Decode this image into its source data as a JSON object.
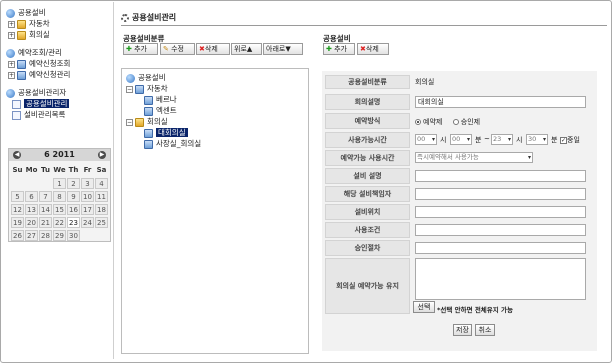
{
  "left_tree": {
    "facility_root": "공용설비",
    "car": "자동차",
    "meeting_room": "회의실",
    "reservation_root": "예약조회/관리",
    "reservation_lookup": "예약신청조회",
    "reservation_manage": "예약신청관리",
    "admin_root": "공용설비관리자",
    "facility_manage": "공용설비관리",
    "facility_list": "설비관리목록"
  },
  "calendar": {
    "month": "6",
    "year": "2011",
    "prev_icon": "chevron-left-icon",
    "next_icon": "chevron-right-icon",
    "weekdays": [
      "Su",
      "Mo",
      "Tu",
      "We",
      "Th",
      "Fr",
      "Sa"
    ],
    "weeks": [
      [
        "",
        "",
        "",
        "1",
        "2",
        "3",
        "4"
      ],
      [
        "5",
        "6",
        "7",
        "8",
        "9",
        "10",
        "11"
      ],
      [
        "12",
        "13",
        "14",
        "15",
        "16",
        "17",
        "18"
      ],
      [
        "19",
        "20",
        "21",
        "22",
        "23",
        "24",
        "25"
      ],
      [
        "26",
        "27",
        "28",
        "29",
        "30",
        "",
        ""
      ]
    ],
    "today": "23"
  },
  "page": {
    "title": "공용설비관리"
  },
  "classification": {
    "title": "공용설비분류",
    "buttons": {
      "add": "추가",
      "edit": "수정",
      "delete": "삭제",
      "up": "위로▲",
      "down": "아래로▼"
    }
  },
  "facility_section": {
    "title": "공용설비",
    "buttons": {
      "add": "추가",
      "delete": "삭제"
    }
  },
  "main_tree": {
    "root": "공용설비",
    "car": "자동차",
    "car_1": "베르나",
    "car_2": "엑센트",
    "meeting_room": "회의실",
    "room_1": "대회의실",
    "room_2": "사장실_회의실"
  },
  "form": {
    "category_label": "공용설비분류",
    "category_value": "회의실",
    "name_label": "회의설명",
    "name_value": "대회의실",
    "method_label": "예약방식",
    "method_options": [
      "예약제",
      "승인제"
    ],
    "time_label": "사용가능시간",
    "time_start_hour": "00",
    "time_start_min": "00",
    "time_end_hour": "23",
    "time_end_min": "30",
    "unit_hour": "시",
    "unit_min": "분",
    "range_sep": "~",
    "stop_label": "중일",
    "status_label": "예약가능 사용시간",
    "status_value": "즉시예약해서 사용가능",
    "desc_label": "설비 설명",
    "manager_label": "해당 설비책임자",
    "location_label": "설비위치",
    "condition_label": "사용조건",
    "approval_label": "승인절차",
    "keep_label": "회의실 예약가능 유지",
    "select_button": "선택",
    "select_note": "*선택 안하면 전체유지 가능",
    "save": "저장",
    "cancel": "취소"
  }
}
